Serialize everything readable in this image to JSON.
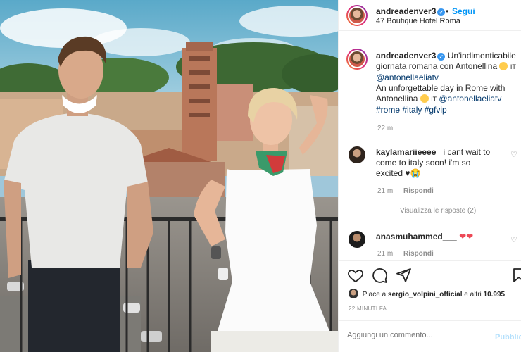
{
  "post_header": {
    "username": "andreadenver3",
    "follow": "Segui",
    "separator": "•",
    "location": "47 Boutique Hotel Roma"
  },
  "caption": {
    "username": "andreadenver3",
    "text_it": "Un'indimenticabile giornata romana con Antonellina",
    "emoji_1": "😊",
    "flag_text": "IT",
    "mention_1": "@antonellaeliatv",
    "text_en": "An unforgettable day in Rome with Antonellina",
    "emoji_2": "😊",
    "flag_text_2": "IT",
    "mention_2": "@antonellaeliatv",
    "hashtags": "#rome #italy #gfvip",
    "time": "22 m"
  },
  "comments": [
    {
      "username": "kaylamariieeee_",
      "text": "i cant wait to come to italy soon! i'm so excited",
      "emoji": "♥😭",
      "time": "21 m",
      "reply": "Rispondi",
      "view_replies": "Visualizza le risposte (2)"
    },
    {
      "username": "anasmuhammed___",
      "text": "❤❤",
      "time": "21 m",
      "reply": "Rispondi"
    }
  ],
  "actions": {
    "like_icon": "heart-icon",
    "comment_icon": "comment-icon",
    "share_icon": "share-icon",
    "save_icon": "bookmark-icon"
  },
  "likes": {
    "prefix": "Piace a",
    "user": "sergio_volpini_official",
    "suffix": "e altri",
    "count": "10.995"
  },
  "timestamp": "22 MINUTI FA",
  "add_comment": {
    "placeholder": "Aggiungi un commento...",
    "publish": "Pubblica"
  },
  "colors": {
    "accent": "#0095f6",
    "like_red": "#ed4956",
    "publish_disabled": "#b2dffc"
  }
}
